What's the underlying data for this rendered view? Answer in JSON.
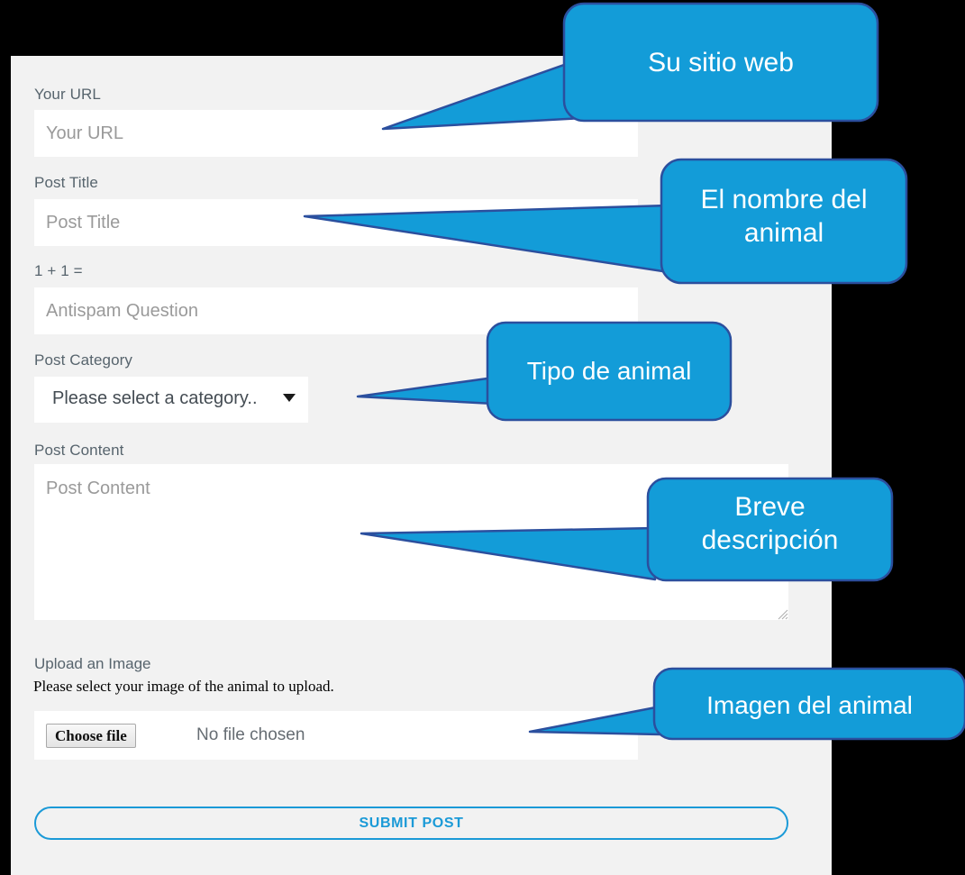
{
  "theme": {
    "page_bg": "#f2f2f2",
    "outer_bg": "#000000",
    "accent": "#1b9ad7",
    "callout_fill": "#139cd8",
    "callout_stroke": "#2b4f9e",
    "label_color": "#57646d",
    "placeholder_color": "#9a9a9a"
  },
  "form": {
    "url": {
      "label": "Your URL",
      "placeholder": "Your URL",
      "value": ""
    },
    "title": {
      "label": "Post Title",
      "placeholder": "Post Title",
      "value": ""
    },
    "antispam": {
      "label": "1 + 1 =",
      "placeholder": "Antispam Question",
      "value": ""
    },
    "category": {
      "label": "Post Category",
      "selected": "Please select a category..",
      "caret_icon": "chevron-down-icon"
    },
    "content": {
      "label": "Post Content",
      "placeholder": "Post Content",
      "value": ""
    },
    "upload": {
      "label": "Upload an Image",
      "description": "Please select your image of the animal to upload.",
      "button_label": "Choose file",
      "status": "No file chosen"
    },
    "submit": {
      "label": "SUBMIT POST"
    }
  },
  "callouts": [
    {
      "id": "callout-url",
      "text": "Su sitio web",
      "font_size": 30
    },
    {
      "id": "callout-title",
      "text": "El nombre del\nanimal",
      "font_size": 30
    },
    {
      "id": "callout-category",
      "text": "Tipo de animal",
      "font_size": 28
    },
    {
      "id": "callout-content",
      "text": "Breve\ndescripción",
      "font_size": 30
    },
    {
      "id": "callout-upload",
      "text": "Imagen del animal",
      "font_size": 28
    }
  ]
}
